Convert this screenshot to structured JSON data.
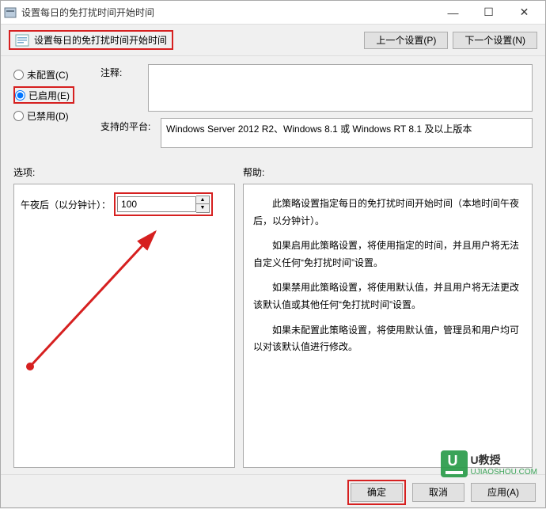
{
  "window": {
    "title": "设置每日的免打扰时间开始时间"
  },
  "toolbar": {
    "title": "设置每日的免打扰时间开始时间",
    "prev": "上一个设置(P)",
    "next": "下一个设置(N)"
  },
  "radio": {
    "not_configured": "未配置(C)",
    "enabled": "已启用(E)",
    "disabled": "已禁用(D)",
    "selected": "enabled"
  },
  "meta": {
    "comment_label": "注释:",
    "comment_value": "",
    "platform_label": "支持的平台:",
    "platform_value": "Windows Server 2012 R2、Windows 8.1 或 Windows RT 8.1 及以上版本"
  },
  "section": {
    "options_label": "选项:",
    "help_label": "帮助:"
  },
  "options": {
    "minutes_label": "午夜后（以分钟计）：",
    "minutes_value": "100"
  },
  "help": {
    "p1": "此策略设置指定每日的免打扰时间开始时间（本地时间午夜后，以分钟计）。",
    "p2": "如果启用此策略设置，将使用指定的时间，并且用户将无法自定义任何“免打扰时间”设置。",
    "p3": "如果禁用此策略设置，将使用默认值，并且用户将无法更改该默认值或其他任何“免打扰时间”设置。",
    "p4": "如果未配置此策略设置，将使用默认值，管理员和用户均可以对该默认值进行修改。"
  },
  "footer": {
    "ok": "确定",
    "cancel": "取消",
    "apply": "应用(A)"
  },
  "watermark": {
    "brand": "U教授",
    "url": "UJIAOSHOU.COM"
  }
}
